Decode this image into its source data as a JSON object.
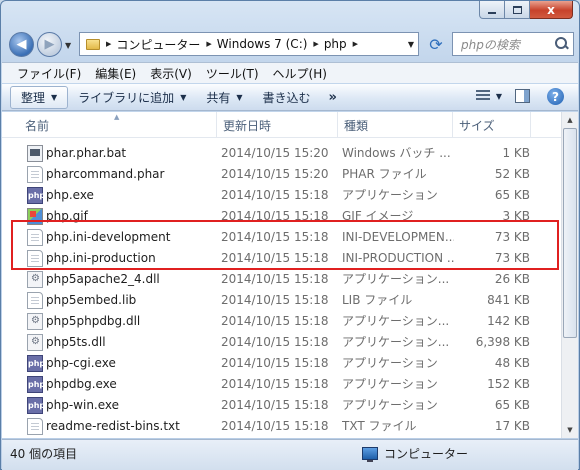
{
  "window": {
    "close_glyph": "x"
  },
  "nav": {
    "back_icon": "arrow-left-icon",
    "forward_icon": "arrow-right-icon",
    "address": [
      "コンピューター",
      "Windows 7 (C:)",
      "php"
    ],
    "search_placeholder": "phpの検索"
  },
  "menubar": {
    "items": [
      "ファイル(F)",
      "編集(E)",
      "表示(V)",
      "ツール(T)",
      "ヘルプ(H)"
    ]
  },
  "commandbar": {
    "organize": "整理",
    "add_to_library": "ライブラリに追加",
    "share": "共有",
    "burn": "書き込む",
    "more": "»"
  },
  "columns": {
    "name": "名前",
    "date": "更新日時",
    "type": "種類",
    "size": "サイズ"
  },
  "files": [
    {
      "name": "phar.phar.bat",
      "date": "2014/10/15 15:20",
      "type": "Windows バッチ ...",
      "size": "1 KB",
      "icon": "bat"
    },
    {
      "name": "pharcommand.phar",
      "date": "2014/10/15 15:20",
      "type": "PHAR ファイル",
      "size": "52 KB",
      "icon": "doc"
    },
    {
      "name": "php.exe",
      "date": "2014/10/15 15:18",
      "type": "アプリケーション",
      "size": "65 KB",
      "icon": "exe"
    },
    {
      "name": "php.gif",
      "date": "2014/10/15 15:18",
      "type": "GIF イメージ",
      "size": "3 KB",
      "icon": "gif"
    },
    {
      "name": "php.ini-development",
      "date": "2014/10/15 15:18",
      "type": "INI-DEVELOPMEN...",
      "size": "73 KB",
      "icon": "doc"
    },
    {
      "name": "php.ini-production",
      "date": "2014/10/15 15:18",
      "type": "INI-PRODUCTION ...",
      "size": "73 KB",
      "icon": "doc"
    },
    {
      "name": "php5apache2_4.dll",
      "date": "2014/10/15 15:18",
      "type": "アプリケーション...",
      "size": "26 KB",
      "icon": "dll"
    },
    {
      "name": "php5embed.lib",
      "date": "2014/10/15 15:18",
      "type": "LIB ファイル",
      "size": "841 KB",
      "icon": "doc"
    },
    {
      "name": "php5phpdbg.dll",
      "date": "2014/10/15 15:18",
      "type": "アプリケーション...",
      "size": "142 KB",
      "icon": "dll"
    },
    {
      "name": "php5ts.dll",
      "date": "2014/10/15 15:18",
      "type": "アプリケーション...",
      "size": "6,398 KB",
      "icon": "dll"
    },
    {
      "name": "php-cgi.exe",
      "date": "2014/10/15 15:18",
      "type": "アプリケーション",
      "size": "48 KB",
      "icon": "exe"
    },
    {
      "name": "phpdbg.exe",
      "date": "2014/10/15 15:18",
      "type": "アプリケーション",
      "size": "152 KB",
      "icon": "exe"
    },
    {
      "name": "php-win.exe",
      "date": "2014/10/15 15:18",
      "type": "アプリケーション",
      "size": "65 KB",
      "icon": "exe"
    },
    {
      "name": "readme-redist-bins.txt",
      "date": "2014/10/15 15:18",
      "type": "TXT ファイル",
      "size": "17 KB",
      "icon": "doc"
    }
  ],
  "exe_icon_text": "php",
  "status": {
    "count": "40 個の項目",
    "location": "コンピューター"
  },
  "colors": {
    "highlight": "#e02020",
    "close": "#c7422b"
  }
}
